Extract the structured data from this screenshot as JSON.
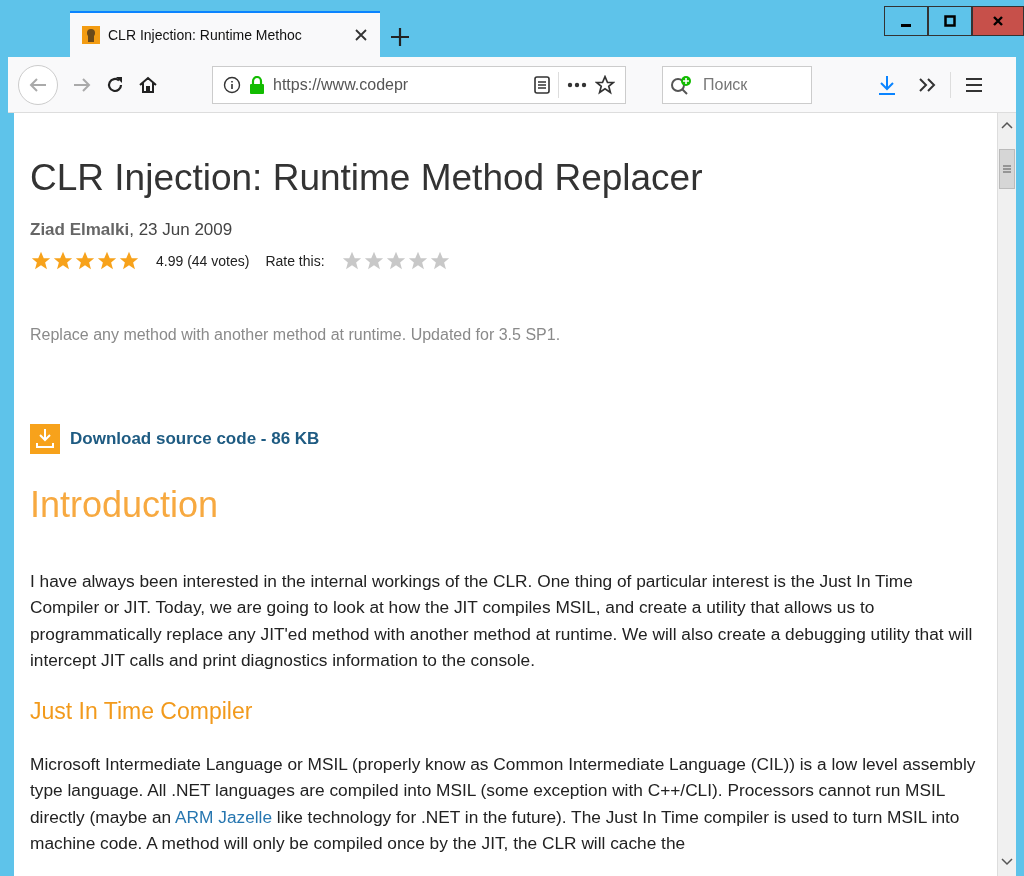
{
  "tab": {
    "title": "CLR Injection: Runtime Methoc",
    "selected": true
  },
  "address": {
    "url": "https://www.codepr"
  },
  "search": {
    "placeholder": "Поиск"
  },
  "article": {
    "title": "CLR Injection: Runtime Method Replacer",
    "byline": "**Ziad Elmalki**, 23 Jun 2009",
    "rating": {
      "stars": 5,
      "score": "4.99 (44 votes)"
    },
    "rate": {
      "label": "Rate this:",
      "stars": 0
    },
    "summary": "Replace any method with another method at runtime. Updated for 3.5 SP1.",
    "download": "Download source code - 86 KB",
    "sections": [
      {
        "heading": "Introduction",
        "kind": "heading",
        "paragraphs": [
          [
            {
              "text": "I have always been interested in the internal workings of the CLR. One thing of particular interest is the Just In Time Compiler or JIT. Today, we are going to look at how the JIT compiles MSIL, and create a utility that allows us to programmatically replace any JIT'ed method with another method at runtime. We will also create a debugging utility that will intercept JIT calls and print diagnostics information to the console."
            }
          ]
        ]
      },
      {
        "heading": "Just In Time Compiler",
        "kind": "subheading",
        "paragraphs": [
          [
            {
              "text": "Microsoft Intermediate Language or MSIL (properly know as Common Intermediate Language (CIL)) is a low level assembly type language. All .NET languages are compiled into MSIL (some exception with C++/CLI). Processors cannot run MSIL directly (maybe an "
            },
            {
              "text": "ARM Jazelle",
              "link": true
            },
            {
              "text": " like technology for .NET in the future). The Just In Time compiler is used to turn MSIL into machine code. A method will only be compiled once by the JIT, the CLR will cache the"
            }
          ]
        ]
      }
    ]
  }
}
